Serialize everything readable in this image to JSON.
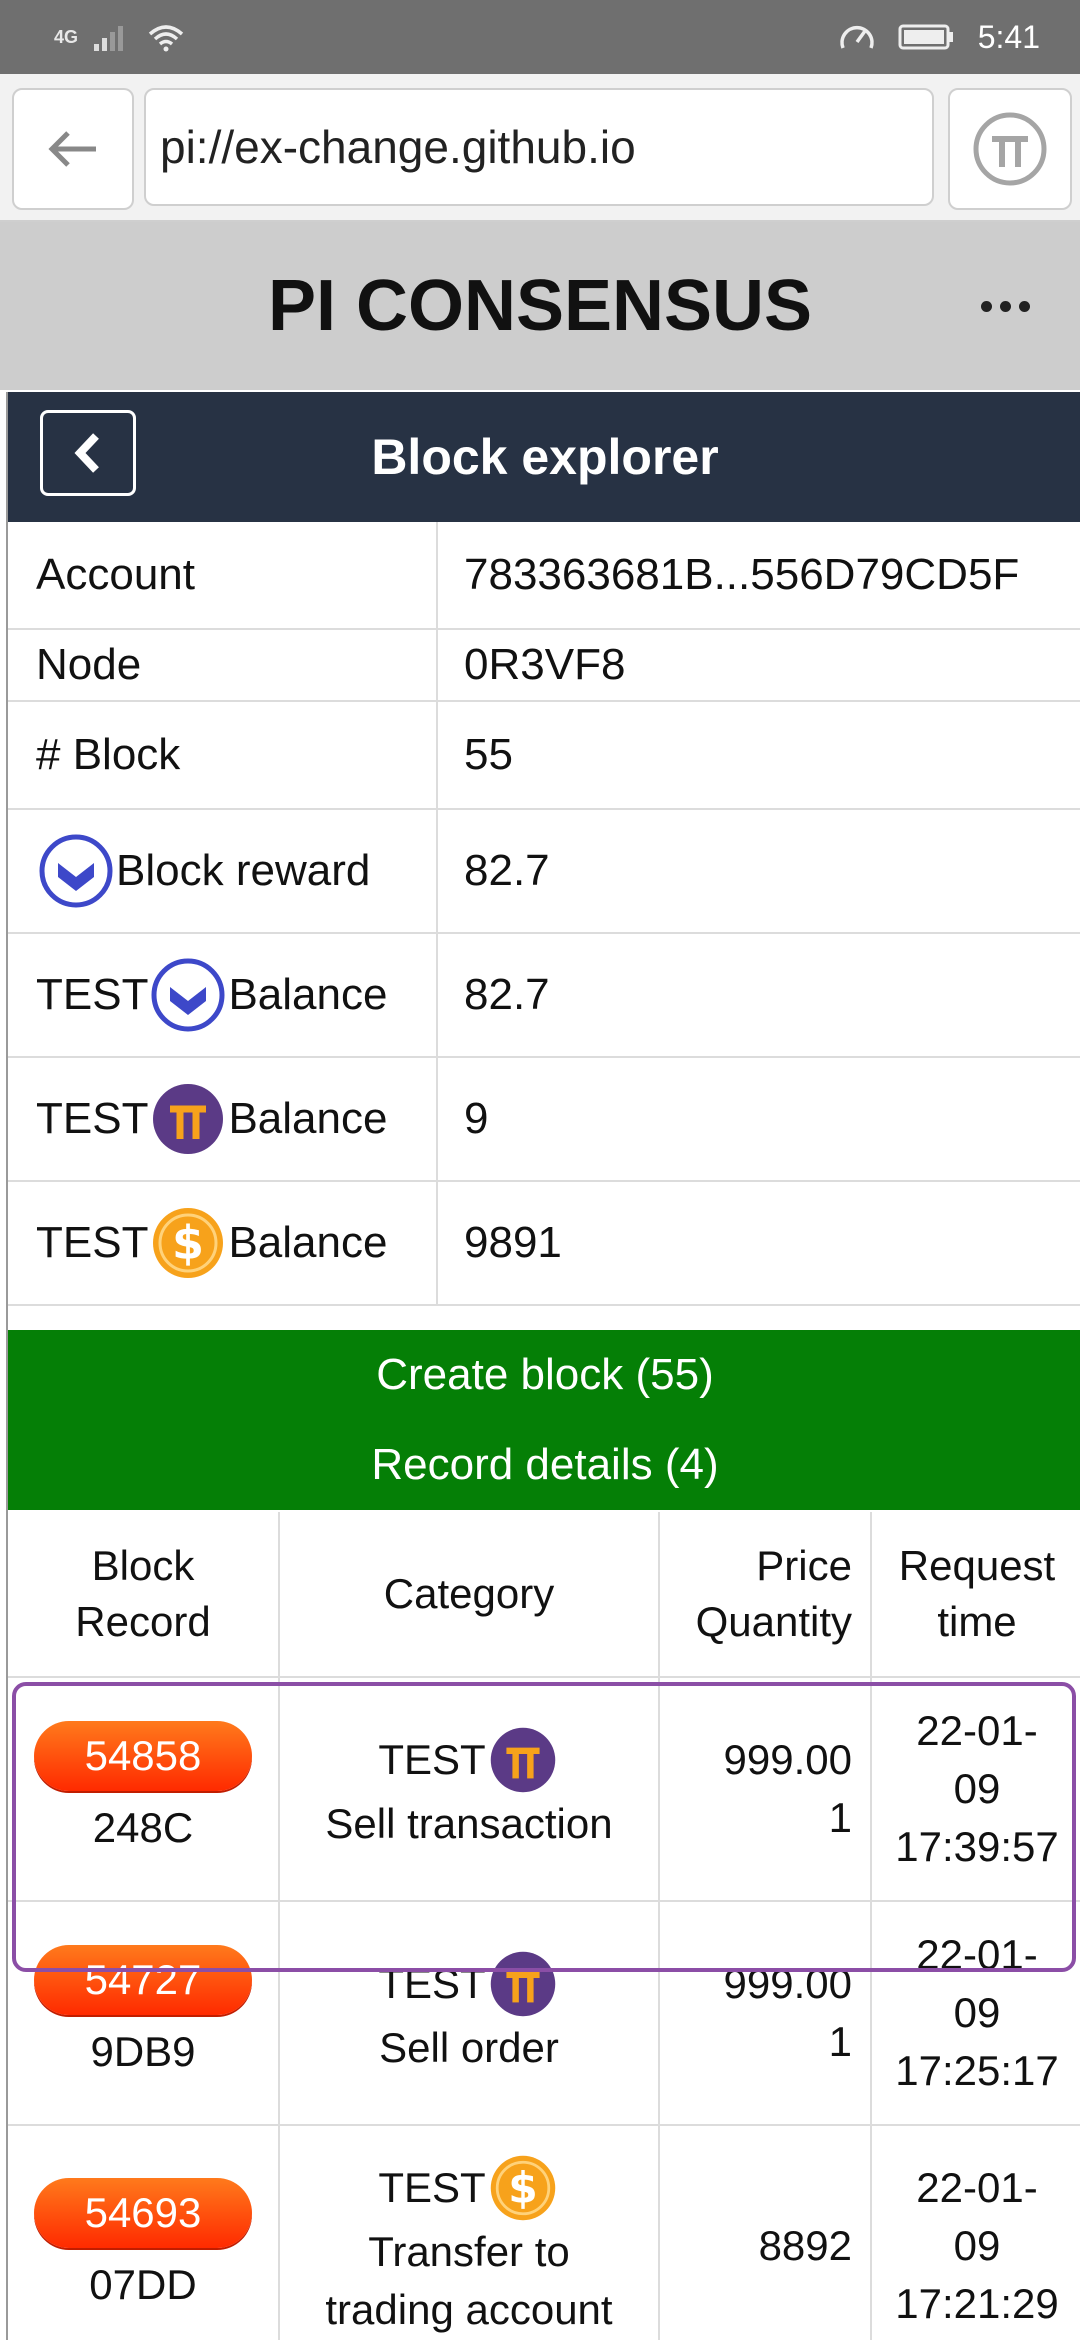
{
  "status_bar": {
    "network": "4G",
    "time": "5:41"
  },
  "browser": {
    "url": "pi://ex-change.github.io"
  },
  "app": {
    "title": "PI CONSENSUS"
  },
  "page": {
    "title": "Block explorer"
  },
  "info": {
    "account_label": "Account",
    "account_value": "783363681B...556D79CD5F",
    "node_label": "Node",
    "node_value": "0R3VF8",
    "block_label": "# Block",
    "block_value": "55",
    "reward_label": "Block reward",
    "reward_value": "82.7",
    "test_prefix": "TEST",
    "balance_label": "Balance",
    "balance_blue_value": "82.7",
    "balance_pi_value": "9",
    "balance_usd_value": "9891"
  },
  "actions": {
    "create_block": "Create block (55)",
    "record_details": "Record details (4)"
  },
  "records": {
    "headers": {
      "col1_l1": "Block",
      "col1_l2": "Record",
      "col2": "Category",
      "col3_l1": "Price",
      "col3_l2": "Quantity",
      "col4_l1": "Request",
      "col4_l2": "time"
    },
    "rows": [
      {
        "block": "54858",
        "record": "248C",
        "cat_prefix": "TEST",
        "icon": "pi-coin-icon",
        "category": "Sell transaction",
        "category2": "",
        "price": "999.00",
        "quantity": "1",
        "time1": "22-01-",
        "time2": "09",
        "time3": "17:39:57"
      },
      {
        "block": "54727",
        "record": "9DB9",
        "cat_prefix": "TEST",
        "icon": "pi-coin-icon",
        "category": "Sell order",
        "category2": "",
        "price": "999.00",
        "quantity": "1",
        "time1": "22-01-",
        "time2": "09",
        "time3": "17:25:17"
      },
      {
        "block": "54693",
        "record": "07DD",
        "cat_prefix": "TEST",
        "icon": "dollar-coin-icon",
        "category": "Transfer to",
        "category2": "trading account",
        "price": "8892",
        "quantity": "",
        "time1": "22-01-",
        "time2": "09",
        "time3": "17:21:29"
      }
    ]
  },
  "colors": {
    "nav_bg": "#273244",
    "green": "#057f06",
    "pill": "#ff4a0a",
    "highlight": "#8b4ea6"
  }
}
